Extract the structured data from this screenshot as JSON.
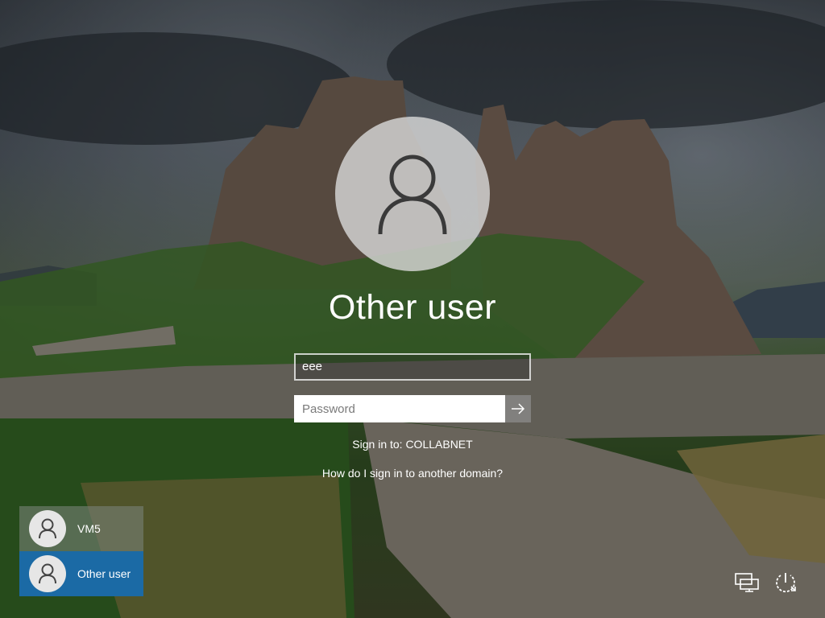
{
  "login": {
    "username_display": "Other user",
    "username_value": "eee",
    "password_placeholder": "Password",
    "submit_icon": "arrow-right-icon",
    "signin_to": "Sign in to: COLLABNET",
    "domain_link": "How do I sign in to another domain?"
  },
  "user_list": [
    {
      "label": "VM5",
      "selected": false
    },
    {
      "label": "Other user",
      "selected": true
    }
  ],
  "system_icons": [
    "network-icon",
    "power-icon"
  ],
  "colors": {
    "selected_tile": "#1b6aa5",
    "avatar_bg": "#d7d7d7"
  }
}
